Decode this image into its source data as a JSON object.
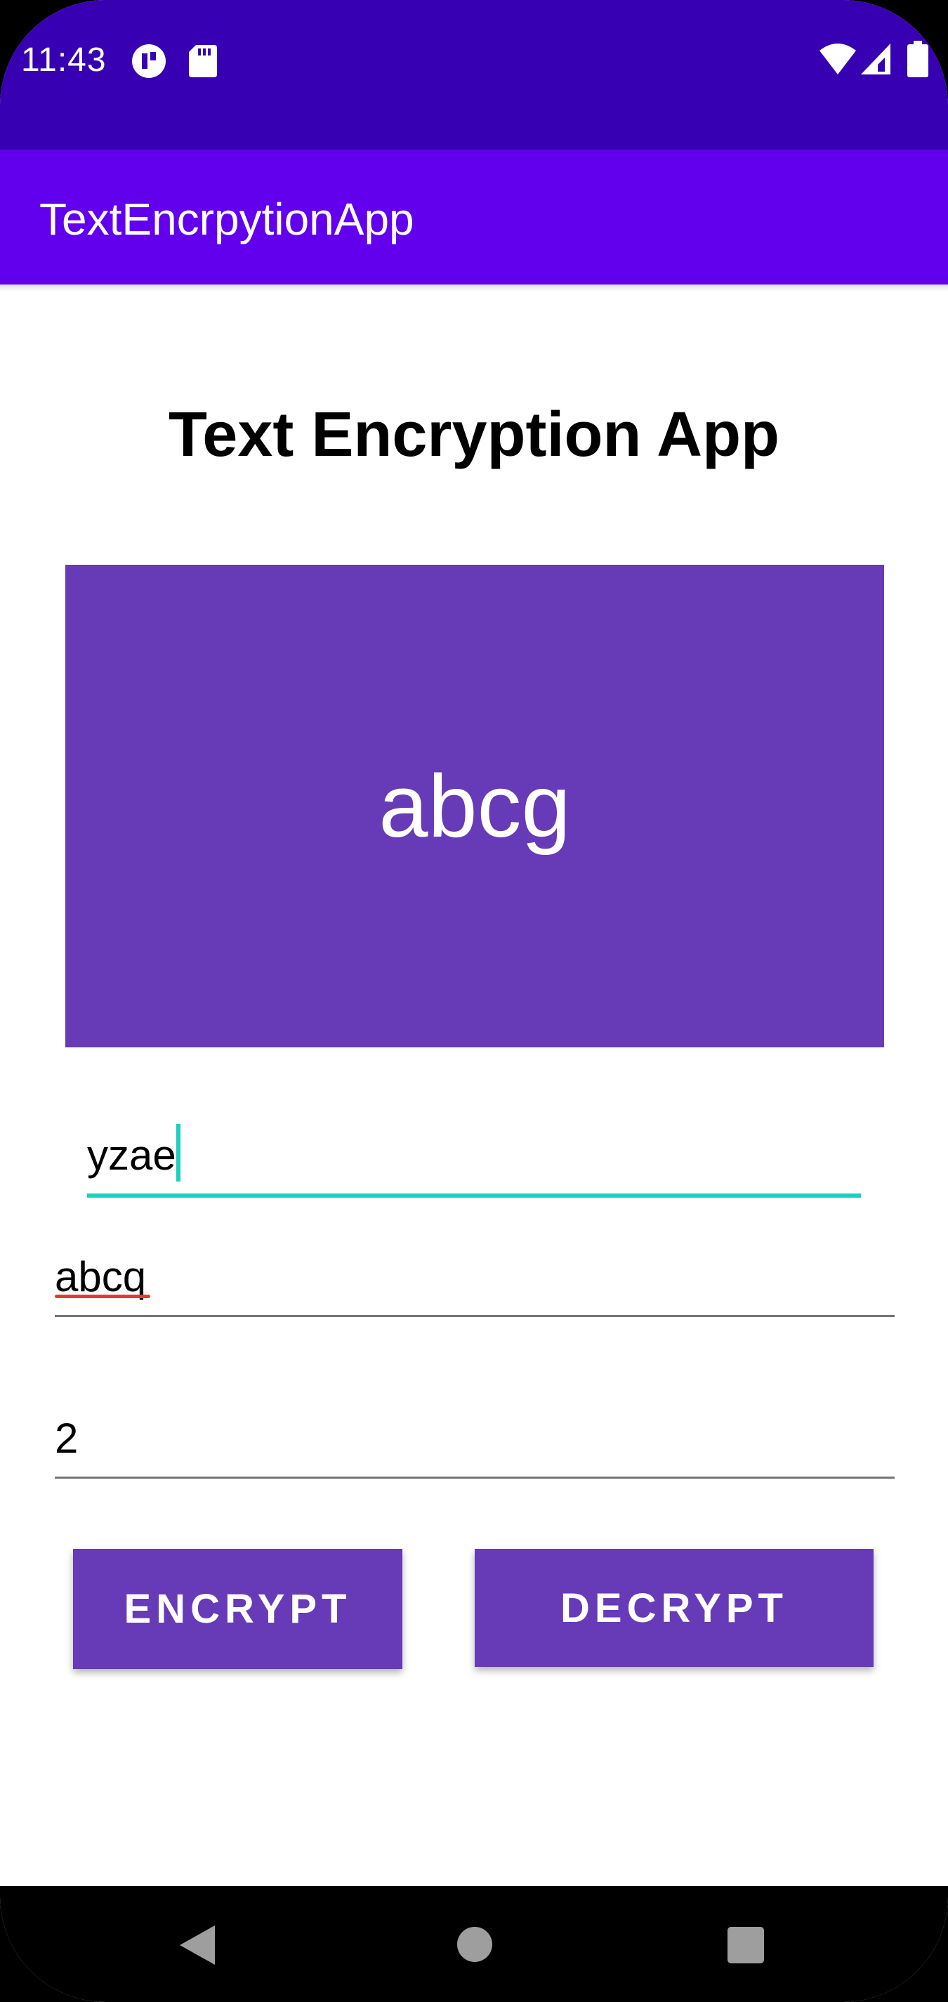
{
  "status_bar": {
    "time": "11:43",
    "icons": [
      "notification-app-icon",
      "sd-card-icon",
      "wifi-icon",
      "signal-icon",
      "battery-icon"
    ],
    "background_color": "#3700b3"
  },
  "app_bar": {
    "title": "TextEncrpytionApp",
    "background_color": "#6200ee"
  },
  "main": {
    "heading": "Text Encryption App",
    "result": {
      "text": "abcg",
      "background_color": "#673ab7"
    },
    "fields": {
      "input_text": "yzae",
      "message_text": "abcq",
      "key_value": "2"
    },
    "buttons": {
      "encrypt_label": "ENCRYPT",
      "decrypt_label": "DECRYPT"
    },
    "accent_color": "#1ccfc0"
  },
  "nav_bar": {
    "icons": [
      "back-icon",
      "home-icon",
      "recents-icon"
    ]
  }
}
